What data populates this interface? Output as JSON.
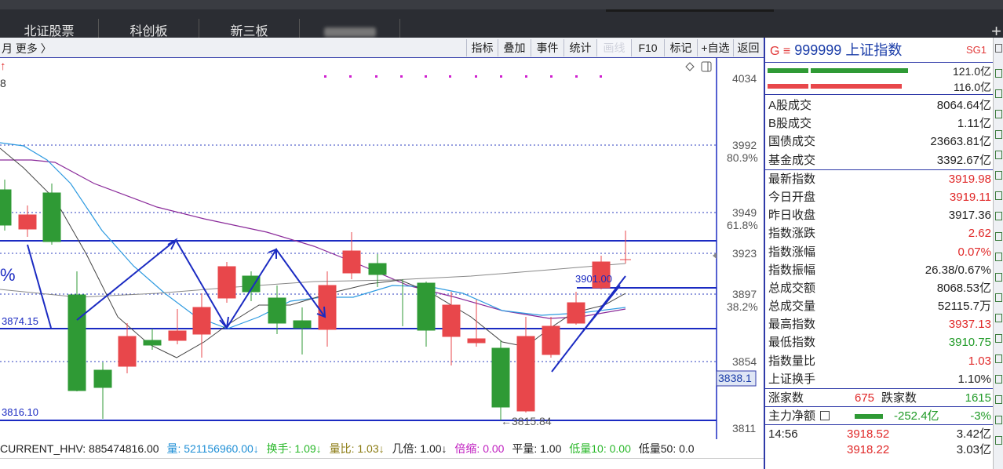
{
  "tabs": [
    {
      "label": "北证股票"
    },
    {
      "label": "科创板"
    },
    {
      "label": "新三板"
    },
    {
      "label": ""
    }
  ],
  "toolbar": {
    "left_text": "月 更多 〉",
    "buttons": [
      "指标",
      "叠加",
      "事件",
      "统计",
      "画线",
      "F10",
      "标记",
      "+自选",
      "返回"
    ]
  },
  "chart": {
    "price_axis": [
      "4034",
      "3992",
      "80.9%",
      "3949",
      "61.8%",
      "3923",
      "3897",
      "38.2%",
      "3854",
      "3838.1",
      "3811"
    ],
    "annotations": {
      "top_left_arrow": "↑",
      "top_left_num": "8",
      "pct_sign": "%",
      "level_3874": "3874.15",
      "level_3816": "3816.10",
      "level_3901": "3901.00",
      "low_label": "←3815.84"
    },
    "icons": [
      "diamond-icon",
      "panel-toggle-icon"
    ]
  },
  "indicator_bar": [
    {
      "label": "CURRENT_HHV: 885474816.00",
      "color": "#222222"
    },
    {
      "label": "量: 521156960.00↓",
      "color": "#1f8fd6"
    },
    {
      "label": "换手: 1.09↓",
      "color": "#2ab82a"
    },
    {
      "label": "量比: 1.03↓",
      "color": "#8a7a10"
    },
    {
      "label": "几倍: 1.00↓",
      "color": "#222222"
    },
    {
      "label": "倍缩: 0.00",
      "color": "#c020c0"
    },
    {
      "label": "平量: 1.00",
      "color": "#222222"
    },
    {
      "label": "低量10: 0.00",
      "color": "#2ab82a"
    },
    {
      "label": "低量50: 0.0",
      "color": "#222222"
    }
  ],
  "panel": {
    "head_prefix": "G ≡",
    "head_title": "999999 上证指数",
    "head_tag": "SG1",
    "vol_up": "121.0亿",
    "vol_down": "116.0亿",
    "turnover": [
      {
        "label": "A股成交",
        "value": "8064.64亿",
        "color": "black"
      },
      {
        "label": "B股成交",
        "value": "1.11亿",
        "color": "black"
      },
      {
        "label": "国债成交",
        "value": "23663.81亿",
        "color": "black"
      },
      {
        "label": "基金成交",
        "value": "3392.67亿",
        "color": "black"
      }
    ],
    "stats": [
      {
        "label": "最新指数",
        "value": "3919.98",
        "color": "red"
      },
      {
        "label": "今日开盘",
        "value": "3919.11",
        "color": "red"
      },
      {
        "label": "昨日收盘",
        "value": "3917.36",
        "color": "black"
      },
      {
        "label": "指数涨跌",
        "value": "2.62",
        "color": "red"
      },
      {
        "label": "指数涨幅",
        "value": "0.07%",
        "color": "red"
      },
      {
        "label": "指数振幅",
        "value": "26.38/0.67%",
        "color": "black"
      },
      {
        "label": "总成交额",
        "value": "8068.53亿",
        "color": "black"
      },
      {
        "label": "总成交量",
        "value": "52115.7万",
        "color": "black"
      },
      {
        "label": "最高指数",
        "value": "3937.13",
        "color": "red"
      },
      {
        "label": "最低指数",
        "value": "3910.75",
        "color": "green"
      },
      {
        "label": "指数量比",
        "value": "1.03",
        "color": "red"
      },
      {
        "label": "上证换手",
        "value": "1.10%",
        "color": "black"
      }
    ],
    "breadth": {
      "up_label": "涨家数",
      "up_value": "675",
      "down_label": "跌家数",
      "down_value": "1615"
    },
    "netflow": {
      "label": "主力净额",
      "value": "-252.4亿",
      "pct": "-3%"
    },
    "ticks": [
      {
        "time": "14:56",
        "price": "3918.52",
        "amount": "3.42亿"
      },
      {
        "time": "",
        "price": "3918.22",
        "amount": "3.03亿"
      }
    ]
  },
  "colors": {
    "up": "#e8474b",
    "down": "#2f9a35",
    "line": "#1b2bc2",
    "ma_purple": "#8a2a9a",
    "ma_blue": "#2d9ae0",
    "ma_black": "#333333"
  }
}
